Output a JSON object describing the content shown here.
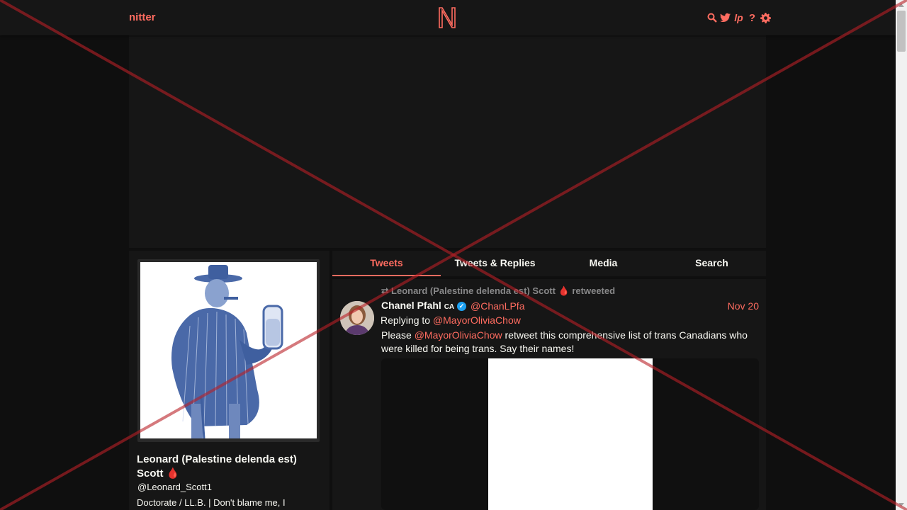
{
  "nav": {
    "brand": "nitter",
    "icons": [
      "search-icon",
      "twitter-icon",
      "liberapay-icon",
      "help-icon",
      "gear-icon"
    ]
  },
  "profile": {
    "fullname": "Leonard (Palestine delenda est) Scott",
    "name_emoji": "🩸",
    "username": "@Leonard_Scott1",
    "bio": "Doctorate / LL.B. | Don't blame me, I"
  },
  "tabs": [
    {
      "label": "Tweets",
      "active": true
    },
    {
      "label": "Tweets & Replies",
      "active": false
    },
    {
      "label": "Media",
      "active": false
    },
    {
      "label": "Search",
      "active": false
    }
  ],
  "tweet": {
    "retweet_name": "Leonard (Palestine delenda est) Scott",
    "retweet_emoji": "🩸",
    "retweet_suffix": "retweeted",
    "author_name": "Chanel Pfahl",
    "author_flag": "CA",
    "author_handle": "@ChanLPfa",
    "date": "Nov 20",
    "replying_prefix": "Replying to",
    "replying_to": "@MayorOliviaChow",
    "text_prefix": "Please",
    "text_mention": "@MayorOliviaChow",
    "text_rest": "retweet this comprehensive list of trans Canadians who were killed for being trans. Say their names!"
  },
  "colors": {
    "accent": "#ff6c60",
    "background": "#0f0f0f",
    "panel": "#161616",
    "text": "#f8f8f2",
    "muted": "#888889"
  }
}
